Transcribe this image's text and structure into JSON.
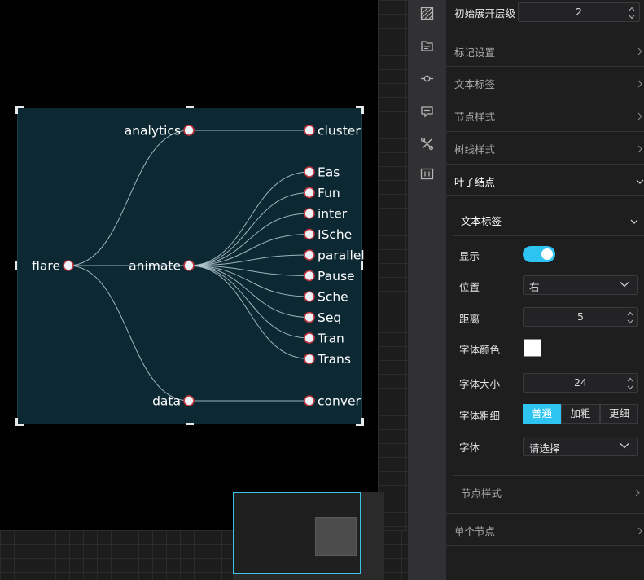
{
  "tree": {
    "root": {
      "name": "flare"
    },
    "branches": [
      {
        "name": "analytics",
        "children": [
          "cluster"
        ]
      },
      {
        "name": "animate",
        "children": [
          "Eas",
          "Fun",
          "inter",
          "ISche",
          "parallel",
          "Pause",
          "Sche",
          "Seq",
          "Tran",
          "Trans"
        ]
      },
      {
        "name": "data",
        "children": [
          "conver"
        ]
      }
    ]
  },
  "colors": {
    "chart_bg": "#0b2833",
    "node_fill": "#eef3f8",
    "node_stroke": "#c0353d",
    "link": "#b9cdd3",
    "accent": "#2ec4f2"
  },
  "icons": [
    "texture-icon",
    "layout-icon",
    "node-line-icon",
    "label-icon",
    "tools-icon",
    "leaf-icon"
  ],
  "panel": {
    "initial_level_label": "初始展开层级",
    "initial_level_value": "2",
    "sections": {
      "marker": "标记设置",
      "text_label": "文本标签",
      "node_style": "节点样式",
      "tree_line": "树线样式",
      "leaf": "叶子结点",
      "single_node": "单个节点"
    },
    "leaf": {
      "text_label_title": "文本标签",
      "show_label": "显示",
      "show_value": true,
      "position_label": "位置",
      "position_value": "右",
      "distance_label": "距离",
      "distance_value": "5",
      "font_color_label": "字体颜色",
      "font_color_value": "#ffffff",
      "font_size_label": "字体大小",
      "font_size_value": "24",
      "font_weight_label": "字体粗细",
      "font_weight_options": [
        "普通",
        "加粗",
        "更细"
      ],
      "font_weight_selected": "普通",
      "font_label": "字体",
      "font_placeholder": "请选择",
      "node_style": "节点样式"
    }
  }
}
